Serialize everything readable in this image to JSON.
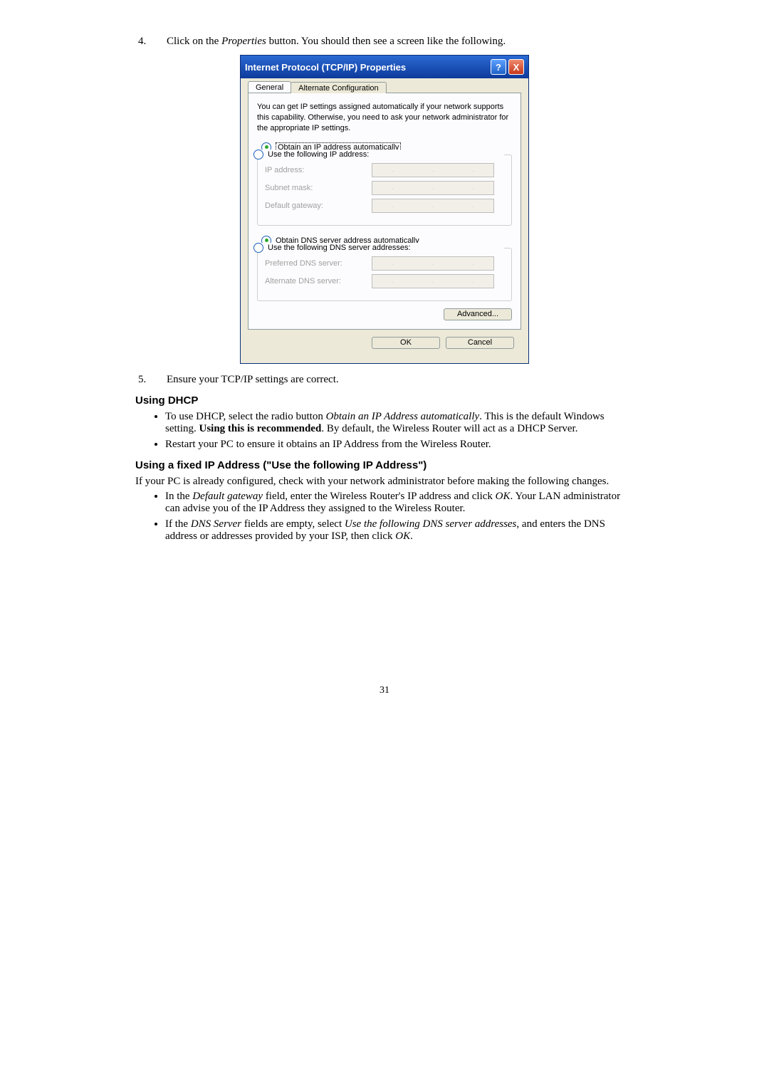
{
  "step4": {
    "num": "4.",
    "text_a": "Click on the ",
    "text_em": "Properties",
    "text_b": " button. You should then see a screen like the following."
  },
  "dialog": {
    "title": "Internet Protocol (TCP/IP) Properties",
    "help": "?",
    "close": "X",
    "tabs": {
      "general": "General",
      "alt": "Alternate Configuration"
    },
    "descr": "You can get IP settings assigned automatically if your network supports this capability. Otherwise, you need to ask your network administrator for the appropriate IP settings.",
    "ip": {
      "auto": "Obtain an IP address automatically",
      "manual": "Use the following IP address:",
      "ip_label": "IP address:",
      "subnet_label": "Subnet mask:",
      "gateway_label": "Default gateway:"
    },
    "dns": {
      "auto": "Obtain DNS server address automatically",
      "manual": "Use the following DNS server addresses:",
      "pref": "Preferred DNS server:",
      "alt": "Alternate DNS server:"
    },
    "advanced": "Advanced...",
    "ok": "OK",
    "cancel": "Cancel"
  },
  "step5": {
    "num": "5.",
    "text": "Ensure your TCP/IP settings are correct."
  },
  "dhcp": {
    "heading": "Using DHCP",
    "b1a": "To use DHCP, select the radio button ",
    "b1em": "Obtain an IP Address automatically",
    "b1b": ". This is the default Windows setting. ",
    "b1strong": "Using this is recommended",
    "b1c": ". By default, the Wireless Router will act as a DHCP Server.",
    "b2": "Restart your PC to ensure it obtains an IP Address from the Wireless Router."
  },
  "fixed": {
    "heading": "Using a fixed IP Address (\"Use the following IP Address\")",
    "intro": "If your PC is already configured, check with your network administrator before making the following changes.",
    "b1a": "In the ",
    "b1em": "Default gateway",
    "b1b": " field, enter the Wireless Router's IP address and click ",
    "b1em2": "OK",
    "b1c": ". Your LAN administrator can advise you of the IP Address they assigned to the Wireless Router.",
    "b2a": "If the ",
    "b2em": "DNS Server",
    "b2b": " fields are empty, select ",
    "b2em2": "Use the following DNS server addresses",
    "b2c": ", and enters the DNS address or addresses provided by your ISP, then click ",
    "b2em3": "OK",
    "b2d": "."
  },
  "pagenum": "31"
}
